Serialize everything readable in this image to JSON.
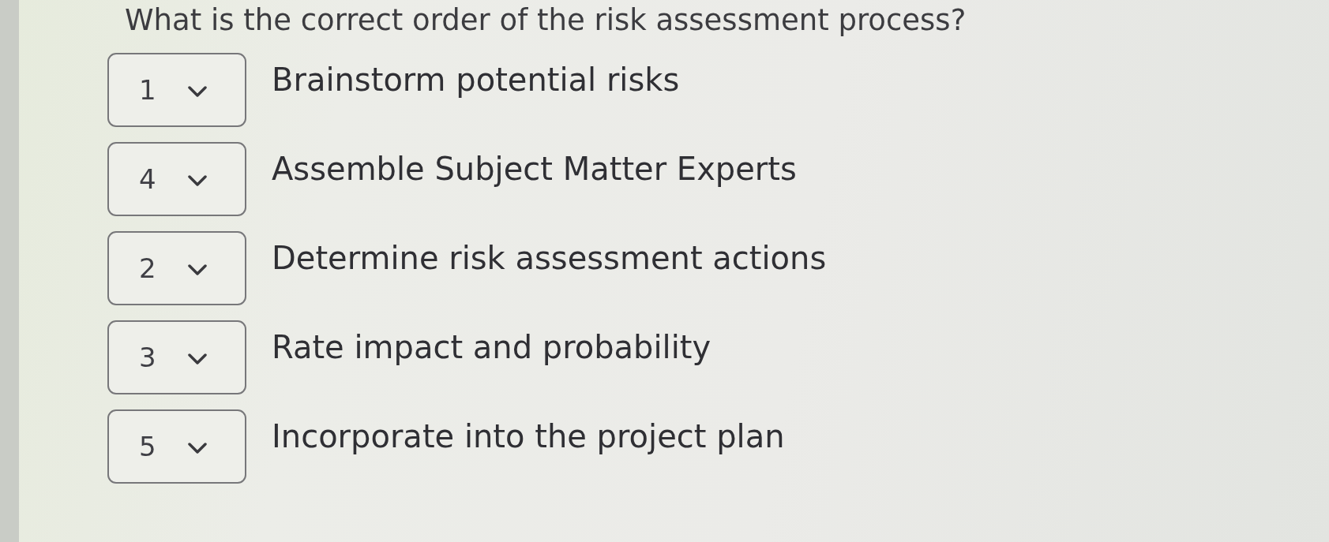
{
  "question": "What is the correct order of the risk assessment process?",
  "items": [
    {
      "answer": "1",
      "statement": "Brainstorm potential risks"
    },
    {
      "answer": "4",
      "statement": "Assemble Subject Matter Experts"
    },
    {
      "answer": "2",
      "statement": "Determine risk assessment actions"
    },
    {
      "answer": "3",
      "statement": "Rate impact and probability"
    },
    {
      "answer": "5",
      "statement": "Incorporate into the project plan"
    }
  ]
}
